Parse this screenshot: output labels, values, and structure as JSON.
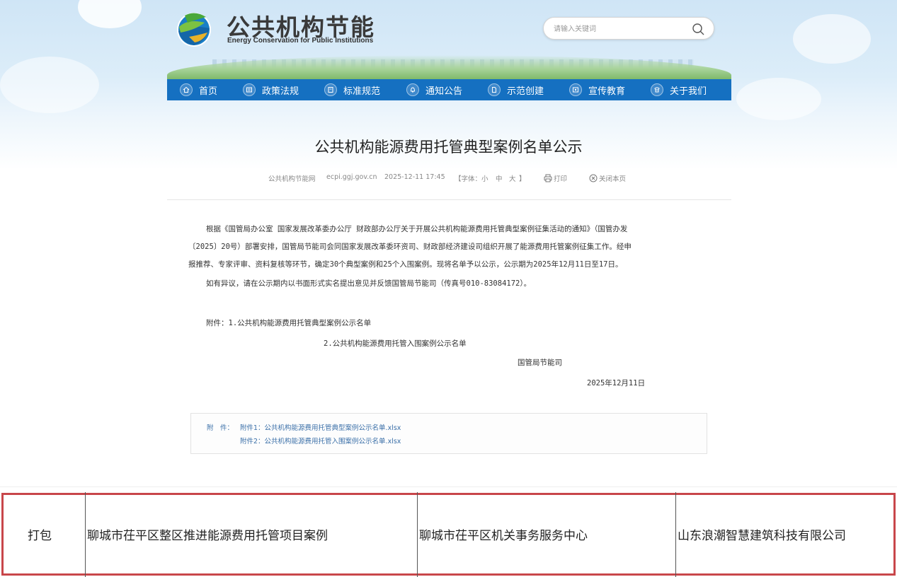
{
  "header": {
    "site_title": "公共机构节能",
    "site_subtitle": "Energy Conservation for Public Institutions",
    "logo_icon": "globe-leaf-icon"
  },
  "search": {
    "placeholder": "请输入关键词",
    "icon": "search-icon"
  },
  "nav": {
    "items": [
      {
        "label": "首页",
        "icon": "home-icon"
      },
      {
        "label": "政策法规",
        "icon": "policy-icon"
      },
      {
        "label": "标准规范",
        "icon": "standard-icon"
      },
      {
        "label": "通知公告",
        "icon": "bell-icon"
      },
      {
        "label": "示范创建",
        "icon": "document-icon"
      },
      {
        "label": "宣传教育",
        "icon": "education-icon"
      },
      {
        "label": "关于我们",
        "icon": "phone-icon"
      }
    ]
  },
  "article": {
    "title": "公共机构能源费用托管典型案例名单公示",
    "meta": {
      "source": "公共机构节能网",
      "domain": "ecpi.ggj.gov.cn",
      "datetime": "2025-12-11 17:45",
      "font_label": "【字体：",
      "font_small": "小",
      "font_medium": "中",
      "font_large": "大",
      "font_close": "】",
      "print": "打印",
      "close": "关闭本页"
    },
    "body": {
      "p1_line1": "根据《国管局办公室 国家发展改革委办公厅 财政部办公厅关于开展公共机构能源费用托管典型案例征集活动的通知》（国管办发",
      "p1_line2": "〔2025〕20号）部署安排，国管局节能司会同国家发展改革委环资司、财政部经济建设司组织开展了能源费用托管案例征集工作。经申",
      "p1_line3": "报推荐、专家评审、资料复核等环节，确定30个典型案例和25个入围案例。现将名单予以公示，公示期为2025年12月11日至17日。",
      "p2": "如有异议，请在公示期内以书面形式实名提出意见并反馈国管局节能司（传真号010-83084172）。",
      "attach1": "附件：1.公共机构能源费用托管典型案例公示名单",
      "attach2": "2.公共机构能源费用托管入围案例公示名单",
      "signer": "国管局节能司",
      "date": "2025年12月11日"
    },
    "attachments": {
      "label": "附　件：",
      "files": [
        "附件1：公共机构能源费用托管典型案例公示名单.xlsx",
        "附件2：公共机构能源费用托管入围案例公示名单.xlsx"
      ]
    }
  },
  "table_row": {
    "cells": [
      "打包",
      "聊城市茌平区整区推进能源费用托管项目案例",
      "聊城市茌平区机关事务服务中心",
      "山东浪潮智慧建筑科技有限公司"
    ],
    "highlight_color": "#c8464a"
  },
  "colors": {
    "nav_bg": "#1570c1",
    "link": "#3a6fa8"
  }
}
